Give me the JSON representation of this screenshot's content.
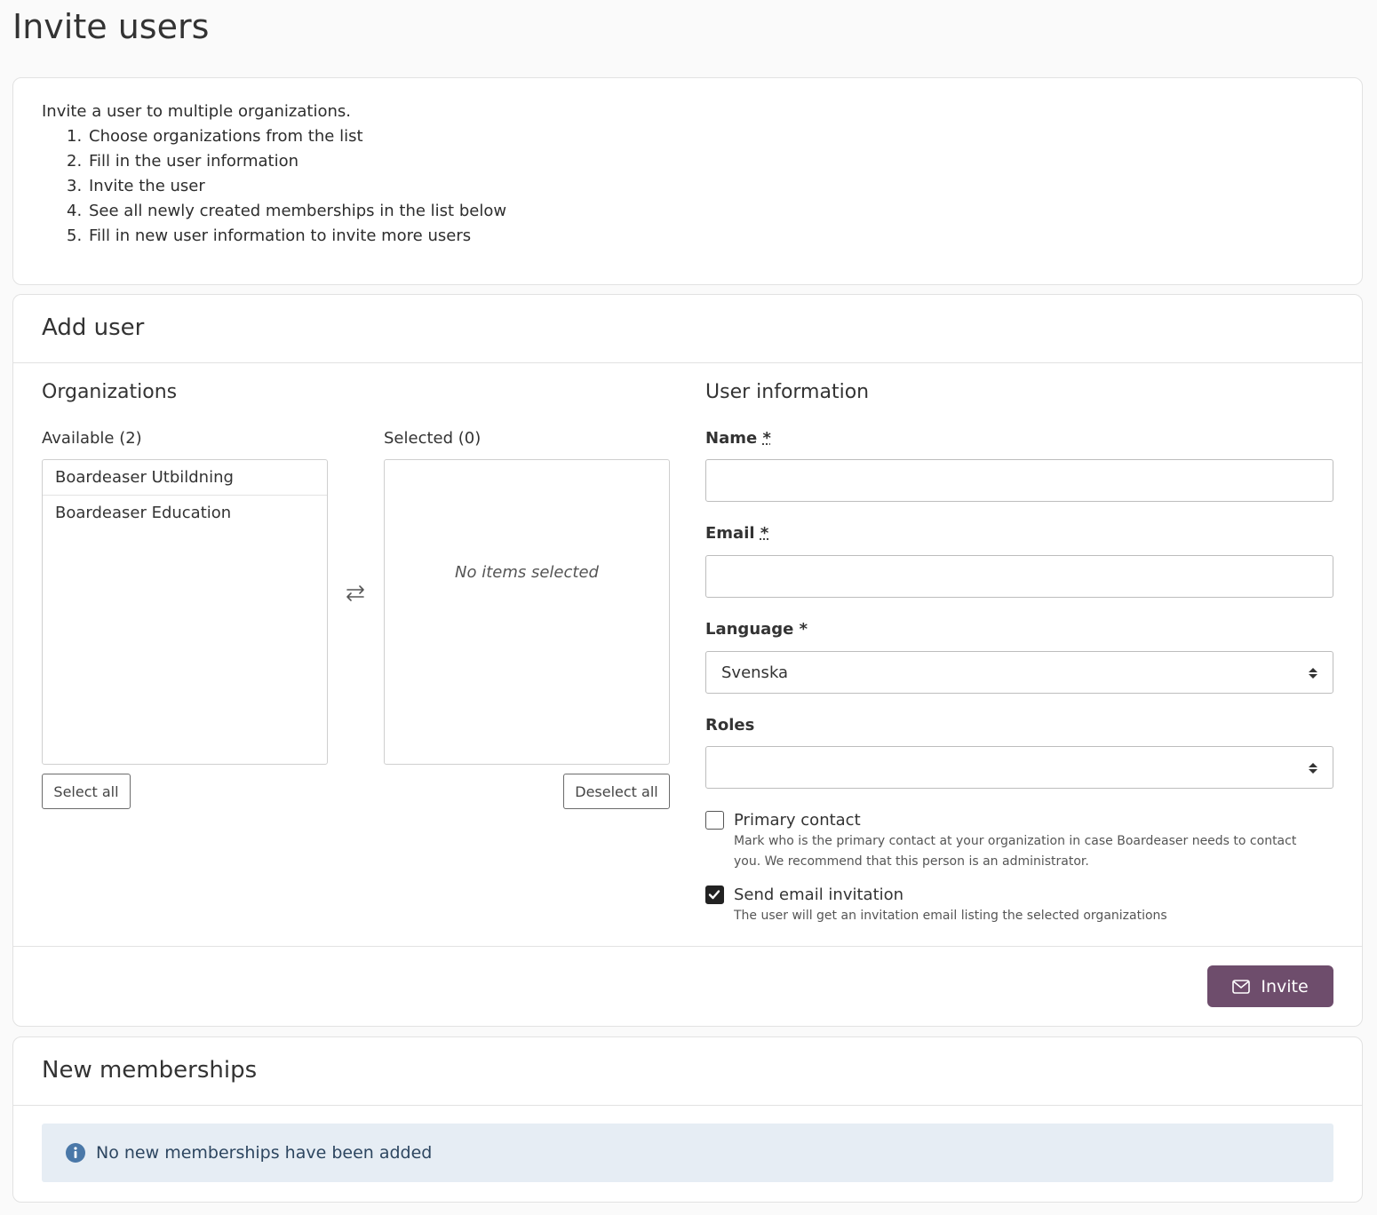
{
  "page": {
    "title": "Invite users"
  },
  "intro": {
    "text": "Invite a user to multiple organizations.",
    "steps": [
      {
        "num": "1.",
        "text": "Choose organizations from the list"
      },
      {
        "num": "2.",
        "text": "Fill in the user information"
      },
      {
        "num": "3.",
        "text": "Invite the user"
      },
      {
        "num": "4.",
        "text": "See all newly created memberships in the list below"
      },
      {
        "num": "5.",
        "text": "Fill in new user information to invite more users"
      }
    ]
  },
  "add_user": {
    "title": "Add user",
    "organizations": {
      "title": "Organizations",
      "available_label": "Available (2)",
      "available_items": [
        "Boardeaser Utbildning",
        "Boardeaser Education"
      ],
      "selected_label": "Selected (0)",
      "empty_text": "No items selected",
      "select_all": "Select all",
      "deselect_all": "Deselect all",
      "transfer_icon": "swap-arrows-icon"
    },
    "user_info": {
      "title": "User information",
      "name_label": "Name",
      "name_value": "",
      "email_label": "Email",
      "email_value": "",
      "language_label": "Language *",
      "language_value": "Svenska",
      "roles_label": "Roles",
      "roles_value": "",
      "required_mark": "*",
      "primary_contact": {
        "label": "Primary contact",
        "checked": false,
        "help_line1": "Mark who is the primary contact at your organization in case Boardeaser needs to contact",
        "help_line2": "you. We recommend that this person is an administrator."
      },
      "send_email": {
        "label": "Send email invitation",
        "checked": true,
        "help": "The user will get an invitation email listing the selected organizations"
      }
    },
    "invite_button": "Invite",
    "invite_icon": "envelope-icon",
    "accent_color": "#6e4d6c"
  },
  "memberships": {
    "title": "New memberships",
    "alert_text": "No new memberships have been added",
    "alert_icon": "info-icon"
  }
}
